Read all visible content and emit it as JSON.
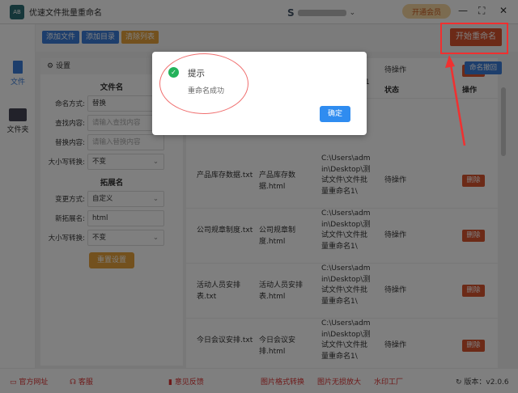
{
  "app": {
    "title": "优速文件批量重命名",
    "logo_text": "AB",
    "user_initial": "S",
    "vip_label": "开通会员",
    "minimize": "—",
    "maximize": "⛶",
    "close": "✕"
  },
  "nav": [
    {
      "label": "文件"
    },
    {
      "label": "文件夹"
    }
  ],
  "toolbar": {
    "add_file": "添加文件",
    "add_dir": "添加目录",
    "clear": "清除列表",
    "start": "开始重命名",
    "rollback": "命名撤回"
  },
  "settings": {
    "header": "设置",
    "filename_section": "文件名",
    "naming_mode_label": "命名方式:",
    "naming_mode": "替换",
    "find_label": "查找内容:",
    "find_placeholder": "请输入查找内容",
    "replace_label": "替换内容:",
    "replace_placeholder": "请输入替换内容",
    "case_label": "大小写转换:",
    "case_value": "不变",
    "ext_section": "拓展名",
    "change_label": "变更方式:",
    "change_value": "自定义",
    "newext_label": "新拓展名:",
    "newext_value": "html",
    "ext_case_label": "大小写转换:",
    "ext_case_value": "不变",
    "reset": "重置设置"
  },
  "table": {
    "headers": {
      "status": "状态",
      "action": "操作"
    },
    "rows": [
      {
        "old": "",
        "new": "",
        "path": "件批量重命名1\\",
        "status": "待操作",
        "action": "删除"
      },
      {
        "old": "产品库存数据.txt",
        "new": "产品库存数据.html",
        "path": "C:\\Users\\admin\\Desktop\\测试文件\\文件批量重命名1\\",
        "status": "待操作",
        "action": "删除"
      },
      {
        "old": "公司规章制度.txt",
        "new": "公司规章制度.html",
        "path": "C:\\Users\\admin\\Desktop\\测试文件\\文件批量重命名1\\",
        "status": "待操作",
        "action": "删除"
      },
      {
        "old": "活动人员安排表.txt",
        "new": "活动人员安排表.html",
        "path": "C:\\Users\\admin\\Desktop\\测试文件\\文件批量重命名1\\",
        "status": "待操作",
        "action": "删除"
      },
      {
        "old": "今日会议安排.txt",
        "new": "今日会议安排.html",
        "path": "C:\\Users\\admin\\Desktop\\测试文件\\文件批量重命名1\\",
        "status": "待操作",
        "action": "删除"
      }
    ]
  },
  "footer": {
    "website": "官方网址",
    "service": "客服",
    "feedback": "意见反馈",
    "img_convert": "图片格式转换",
    "img_enlarge": "图片无损放大",
    "watermark": "水印工厂",
    "version": "版本：v2.0.6"
  },
  "dialog": {
    "title": "提示",
    "message": "重命名成功",
    "ok": "确定"
  }
}
